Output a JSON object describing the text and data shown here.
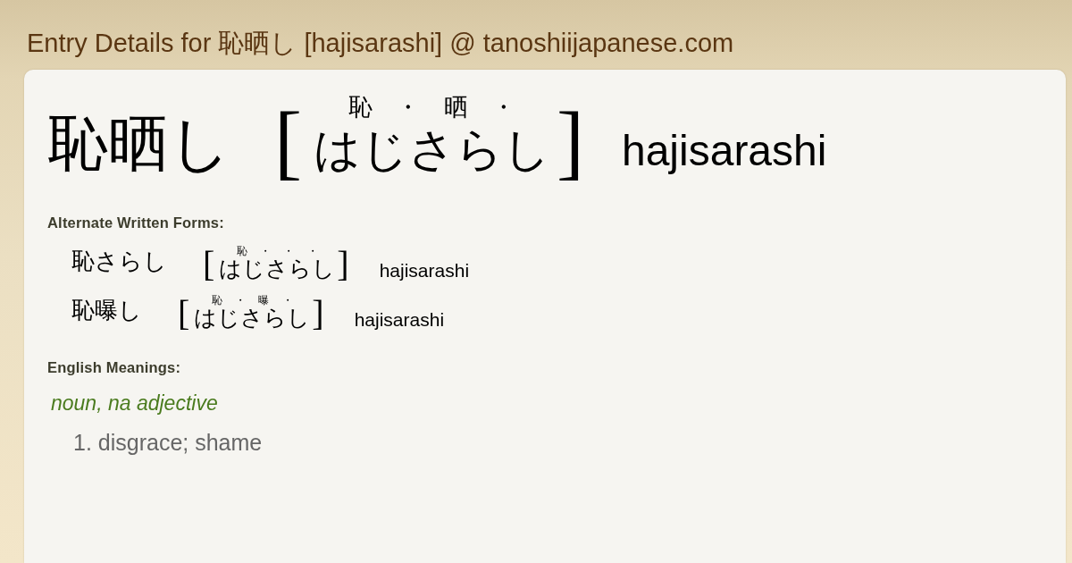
{
  "page": {
    "title": "Entry Details for 恥晒し [hajisarashi] @ tanoshiijapanese.com"
  },
  "entry": {
    "word": "恥晒し",
    "reading": {
      "open": "[",
      "marks": [
        "恥",
        "・",
        "晒",
        "・"
      ],
      "kana": "はじさらし",
      "close": "]"
    },
    "romaji": "hajisarashi"
  },
  "alternate_forms": {
    "heading": "Alternate Written Forms:",
    "items": [
      {
        "word": "恥さらし",
        "reading": {
          "open": "[",
          "marks": [
            "恥",
            "・",
            "・",
            "・"
          ],
          "kana": "はじさらし",
          "close": "]"
        },
        "romaji": "hajisarashi"
      },
      {
        "word": "恥曝し",
        "reading": {
          "open": "[",
          "marks": [
            "恥",
            "・",
            "曝",
            "・"
          ],
          "kana": "はじさらし",
          "close": "]"
        },
        "romaji": "hajisarashi"
      }
    ]
  },
  "meanings": {
    "heading": "English Meanings:",
    "groups": [
      {
        "part_of_speech": "noun, na adjective",
        "definitions": [
          "1. disgrace; shame"
        ]
      }
    ]
  }
}
